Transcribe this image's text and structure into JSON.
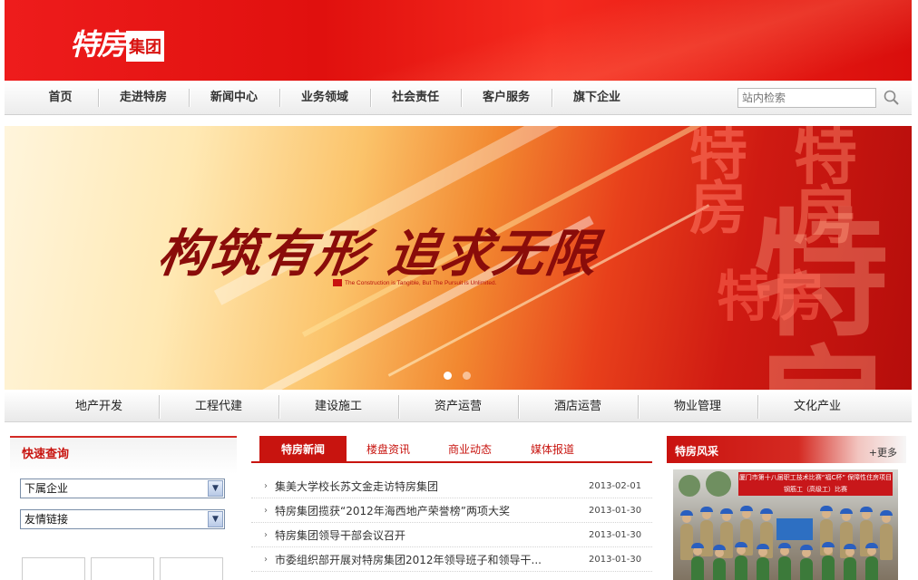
{
  "header": {
    "logo_text": "特房",
    "logo_seal": "集团"
  },
  "nav": {
    "items": [
      "首页",
      "走进特房",
      "新闻中心",
      "业务领域",
      "社会责任",
      "客户服务",
      "旗下企业"
    ],
    "search_placeholder": "站内检索",
    "search_icon": "search-icon"
  },
  "hero": {
    "slogan": "构筑有形 追求无限",
    "slogan_en": "The Construction is Tangible, But The Pursuit is Unlimited.",
    "motif_text": "特房",
    "slides": 2,
    "active_slide": 1
  },
  "subnav": {
    "items": [
      "地产开发",
      "工程代建",
      "建设施工",
      "资产运营",
      "酒店运营",
      "物业管理",
      "文化产业"
    ]
  },
  "quick": {
    "title": "快速查询",
    "select1": "下属企业",
    "select2": "友情链接"
  },
  "news": {
    "tabs": [
      "特房新闻",
      "楼盘资讯",
      "商业动态",
      "媒体报道"
    ],
    "active_tab": 0,
    "items": [
      {
        "title": "集美大学校长苏文金走访特房集团",
        "date": "2013-02-01"
      },
      {
        "title": "特房集团揽获“2012年海西地产荣誉榜”两项大奖",
        "date": "2013-01-30"
      },
      {
        "title": "特房集团领导干部会议召开",
        "date": "2013-01-30"
      },
      {
        "title": "市委组织部开展对特房集团2012年领导班子和领导干...",
        "date": "2013-01-30"
      }
    ]
  },
  "gallery": {
    "title": "特房风采",
    "more": "+更多",
    "banner_text": "厦门市第十八届职工技术比赛“福C杯” 保障性住房项目钢筋工（高级工）比赛"
  },
  "colors": {
    "brand_red": "#c8140f",
    "header_red": "#e0100e"
  }
}
